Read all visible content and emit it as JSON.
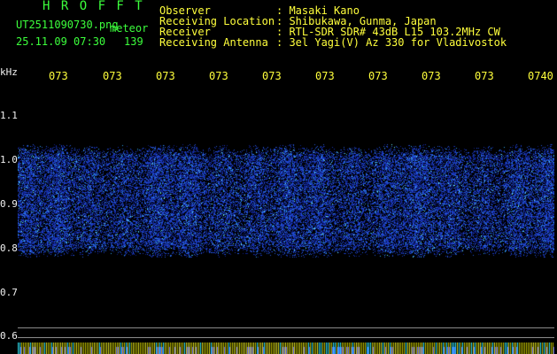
{
  "header": {
    "brand": "H R O F F T",
    "filename": "UT2511090730.png",
    "meteor_label": "meteor",
    "datetime": "25.11.09 07:30",
    "meteor_count": "139"
  },
  "station": {
    "labels": [
      "Observer",
      "Receiving Location",
      "Receiver",
      "Receiving Antenna"
    ],
    "values": [
      ": Masaki Kano",
      ": Shibukawa, Gunma, Japan",
      ": RTL-SDR SDR# 43dB L15 103.2MHz CW",
      ": 3el Yagi(V) Az 330 for Vladivostok"
    ]
  },
  "axis": {
    "y_unit": "kHz",
    "y_ticks": [
      "1.1",
      "1.0",
      "0.9",
      "0.8",
      "0.7",
      "0.6"
    ],
    "x_ticks": [
      "073",
      "073",
      "073",
      "073",
      "073",
      "073",
      "073",
      "073",
      "073",
      "0740"
    ]
  },
  "colors": {
    "background": "#000000",
    "signal_band": "#1c3cd0",
    "signal_highlight": "#4ce0e0",
    "label_green": "#3cff3c",
    "label_yellow": "#ffff3c"
  }
}
